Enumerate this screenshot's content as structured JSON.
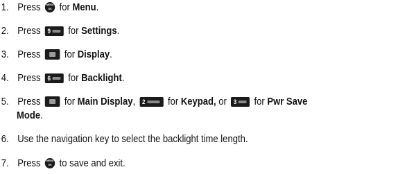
{
  "steps": [
    {
      "num": "1.",
      "press": "Press",
      "for": "for",
      "target": "Menu",
      "end": "."
    },
    {
      "num": "2.",
      "press": "Press",
      "for": "for",
      "target": "Settings",
      "end": "."
    },
    {
      "num": "3.",
      "press": "Press",
      "for": "for",
      "target": "Display",
      "end": "."
    },
    {
      "num": "4.",
      "press": "Press",
      "for": "for",
      "target": "Backlight",
      "end": "."
    },
    {
      "num": "5.",
      "press": "Press",
      "for1": "for",
      "target1": "Main Display",
      "comma": ",",
      "for2": "for",
      "target2": "Keypad,",
      "or": "or",
      "for3": "for",
      "target3": "Pwr Save",
      "target3b": "Mode",
      "end": "."
    },
    {
      "num": "6.",
      "text": "Use the navigation key to select the backlight time length."
    },
    {
      "num": "7.",
      "press": "Press",
      "text": "to save and exit."
    }
  ],
  "keys": {
    "menu_ok": {
      "icon": "menu-ok-key-icon",
      "label_top": "MENU",
      "label_bottom": "OK"
    },
    "key9": {
      "icon": "key-9-icon",
      "digit": "9"
    },
    "nav_left": {
      "icon": "left-soft-key-icon"
    },
    "key6": {
      "icon": "key-6-icon",
      "digit": "6"
    },
    "key2": {
      "icon": "key-2-icon",
      "digit": "2"
    },
    "key3": {
      "icon": "key-3-icon",
      "digit": "3"
    }
  }
}
